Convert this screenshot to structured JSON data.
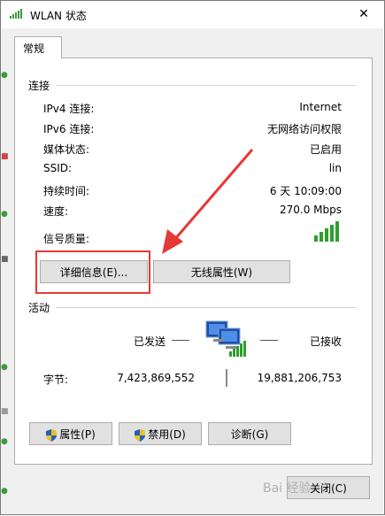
{
  "window": {
    "title": "WLAN 状态",
    "close_glyph": "✕"
  },
  "tabs": [
    {
      "label": "常规"
    }
  ],
  "connection": {
    "group_label": "连接",
    "rows": [
      {
        "label": "IPv4 连接:",
        "value": "Internet"
      },
      {
        "label": "IPv6 连接:",
        "value": "无网络访问权限"
      },
      {
        "label": "媒体状态:",
        "value": "已启用"
      },
      {
        "label": "SSID:",
        "value": "lin"
      },
      {
        "label": "持续时间:",
        "value": "6 天 10:09:00"
      },
      {
        "label": "速度:",
        "value": "270.0 Mbps"
      }
    ],
    "signal_label": "信号质量:",
    "signal_bars": 5,
    "details_button": "详细信息(E)...",
    "wireless_button": "无线属性(W)"
  },
  "activity": {
    "group_label": "活动",
    "sent_label": "已发送",
    "received_label": "已接收",
    "bytes_label": "字节:",
    "bytes_sent": "7,423,869,552",
    "bytes_received": "19,881,206,753"
  },
  "buttons": {
    "properties": "属性(P)",
    "disable": "禁用(D)",
    "diagnose": "诊断(G)",
    "close": "关闭(C)"
  },
  "overlay": {
    "watermark": "Bai 经验",
    "accent_color": "#e53935"
  },
  "icons": [
    "wifi-signal-icon",
    "close-icon",
    "signal-quality-icon",
    "network-computers-icon",
    "shield-icon"
  ]
}
